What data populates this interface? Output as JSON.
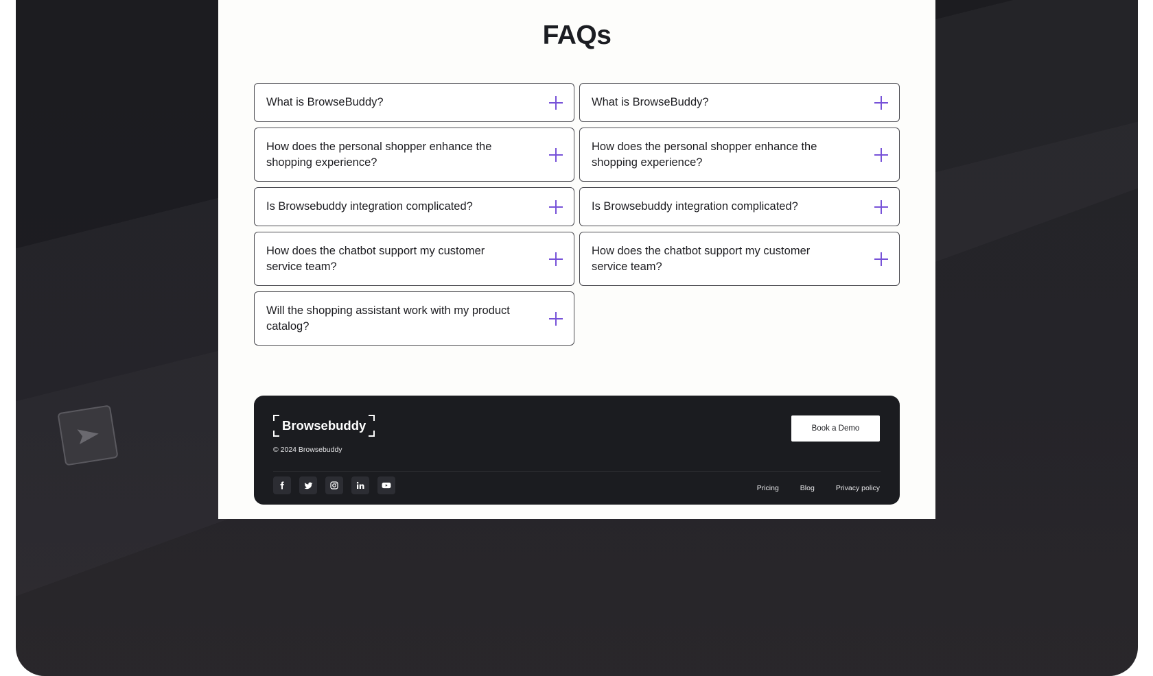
{
  "faq": {
    "title": "FAQs",
    "items": [
      {
        "question": "What is BrowseBuddy?"
      },
      {
        "question": "What is BrowseBuddy?"
      },
      {
        "question": "How does the personal shopper enhance the shopping experience?"
      },
      {
        "question": "How does the personal shopper enhance the shopping experience?"
      },
      {
        "question": "Is Browsebuddy integration complicated?"
      },
      {
        "question": "Is Browsebuddy integration complicated?"
      },
      {
        "question": "How does the chatbot support my customer service team?"
      },
      {
        "question": "How does the chatbot support my customer service team?"
      },
      {
        "question": "Will the shopping assistant work with my product catalog?"
      }
    ],
    "expand_icon": "plus-icon",
    "accent_color": "#7752d8"
  },
  "footer": {
    "brand": "Browsebuddy",
    "copyright": "© 2024 Browsebuddy",
    "cta": "Book a Demo",
    "socials": [
      "facebook-icon",
      "twitter-icon",
      "instagram-icon",
      "linkedin-icon",
      "youtube-icon"
    ],
    "links": [
      "Pricing",
      "Blog",
      "Privacy policy"
    ],
    "background_color": "#1b1c20"
  }
}
